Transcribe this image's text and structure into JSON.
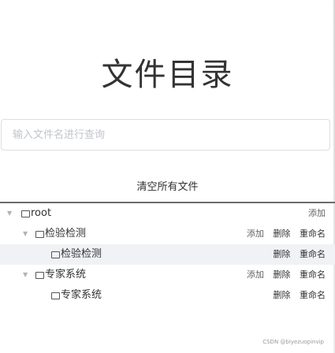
{
  "page": {
    "title": "文件目录"
  },
  "search": {
    "placeholder": "输入文件名进行查询"
  },
  "clear_label": "清空所有文件",
  "tree": {
    "root": {
      "label": "root",
      "actions": {
        "add": "添加"
      }
    },
    "children": [
      {
        "label": "检验检测",
        "actions": {
          "add": "添加",
          "delete": "删除",
          "rename": "重命名"
        },
        "child": {
          "label": "检验检测",
          "actions": {
            "delete": "删除",
            "rename": "重命名"
          }
        }
      },
      {
        "label": "专家系统",
        "actions": {
          "add": "添加",
          "delete": "删除",
          "rename": "重命名"
        },
        "child": {
          "label": "专家系统",
          "actions": {
            "delete": "删除",
            "rename": "重命名"
          }
        }
      }
    ]
  },
  "watermark": "CSDN @biyezuopinvip"
}
